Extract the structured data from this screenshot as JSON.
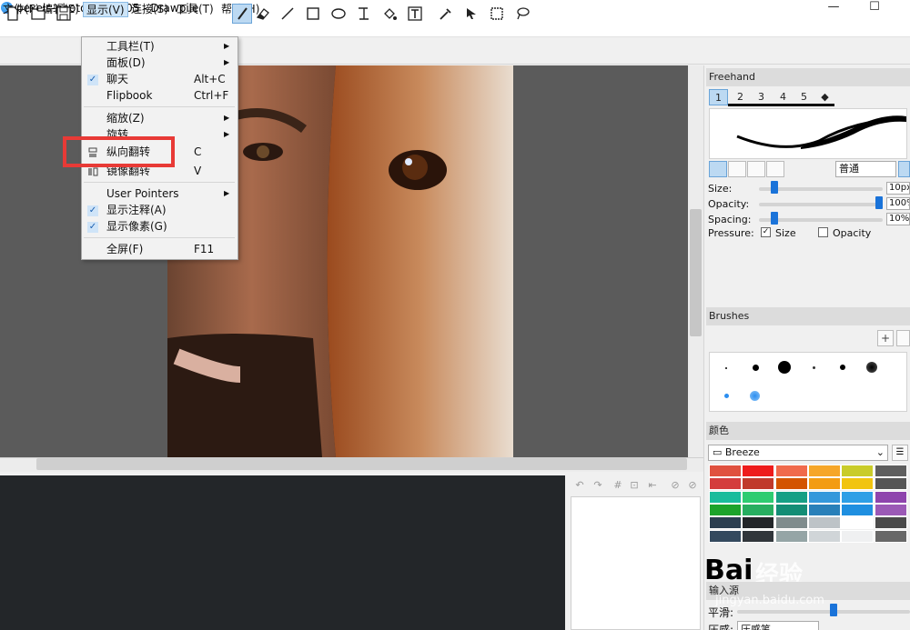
{
  "window": {
    "title": "pexels-photo-3452005 - Drawpile",
    "minimize_icon": "minimize-icon",
    "maximize_icon": "maximize-icon"
  },
  "menubar": [
    {
      "label": "文件(F)",
      "active": false
    },
    {
      "label": "编辑(E)",
      "active": false
    },
    {
      "label": "显示(V)",
      "active": true
    },
    {
      "label": "连接(S)",
      "active": false
    },
    {
      "label": "工具(T)",
      "active": false
    },
    {
      "label": "帮助(H)",
      "active": false
    }
  ],
  "dropdown": {
    "items": [
      {
        "label": "工具栏(T)",
        "shortcut": "",
        "submenu": true,
        "checked": false
      },
      {
        "label": "面板(D)",
        "shortcut": "",
        "submenu": true,
        "checked": false
      },
      {
        "label": "聊天",
        "shortcut": "Alt+C",
        "submenu": false,
        "checked": true
      },
      {
        "label": "Flipbook",
        "shortcut": "Ctrl+F",
        "submenu": false,
        "checked": false
      },
      {
        "label": "缩放(Z)",
        "shortcut": "",
        "submenu": true,
        "checked": false
      },
      {
        "label": "旋转",
        "shortcut": "",
        "submenu": true,
        "checked": false
      },
      {
        "label": "纵向翻转",
        "shortcut": "C",
        "submenu": false,
        "checked": false
      },
      {
        "label": "镜像翻转",
        "shortcut": "V",
        "submenu": false,
        "checked": false
      },
      {
        "label": "User Pointers",
        "shortcut": "",
        "submenu": true,
        "checked": false
      },
      {
        "label": "显示注释(A)",
        "shortcut": "",
        "submenu": false,
        "checked": true
      },
      {
        "label": "显示像素(G)",
        "shortcut": "",
        "submenu": false,
        "checked": true
      },
      {
        "label": "全屏(F)",
        "shortcut": "F11",
        "submenu": false,
        "checked": false
      }
    ],
    "highlight_color": "#e83a36"
  },
  "toolbar": {
    "icons": [
      "new-file-icon",
      "open-file-icon",
      "save-icon",
      "eraser-icon",
      "line-icon",
      "rectangle-icon",
      "ellipse-icon",
      "bezier-icon",
      "fill-icon",
      "text-icon",
      "color-picker-icon",
      "move-pointer-icon",
      "select-rect-icon",
      "lasso-icon"
    ]
  },
  "brush_panel": {
    "title": "Freehand",
    "tabs": [
      "1",
      "2",
      "3",
      "4",
      "5"
    ],
    "blend_mode": "普通",
    "size_label": "Size:",
    "size_value": "10px",
    "size_fraction": 0.1,
    "opacity_label": "Opacity:",
    "opacity_value": "100%",
    "opacity_fraction": 1.0,
    "spacing_label": "Spacing:",
    "spacing_value": "10%",
    "spacing_fraction": 0.1,
    "pressure_label": "Pressure:",
    "pressure_size_label": "Size",
    "pressure_size_checked": true,
    "pressure_opacity_label": "Opacity",
    "pressure_opacity_checked": false
  },
  "brushes_panel": {
    "title": "Brushes"
  },
  "color_panel": {
    "title": "颜色",
    "palette_name": "Breeze",
    "swatches": [
      "#e0513f",
      "#ee1c1c",
      "#f06a4c",
      "#f6a628",
      "#c9cc2a",
      "#5e5e5e",
      "#d43d3d",
      "#c0392b",
      "#d35400",
      "#f39c12",
      "#f1c40f",
      "#555555",
      "#1abc9c",
      "#2ecc71",
      "#16a085",
      "#3498db",
      "#2e9fe6",
      "#8e44ad",
      "#1ca32b",
      "#27ae60",
      "#138d75",
      "#2980b9",
      "#1f8fe0",
      "#9b59b6",
      "#2c3e50",
      "#232629",
      "#7f8c8d",
      "#bdc3c7",
      "#ffffff",
      "#4a4a4a",
      "#34495e",
      "#31363b",
      "#95a5a6",
      "#d0d5d8",
      "#eff0f1",
      "#676767"
    ]
  },
  "input_panel": {
    "title": "输入源",
    "smoothing_label": "平滑:",
    "pressure_label": "压感:",
    "pressure_value": "压感笔"
  },
  "watermark": {
    "logo": "Bai",
    "brand": "经验",
    "url": "jingyan.baidu.com"
  }
}
